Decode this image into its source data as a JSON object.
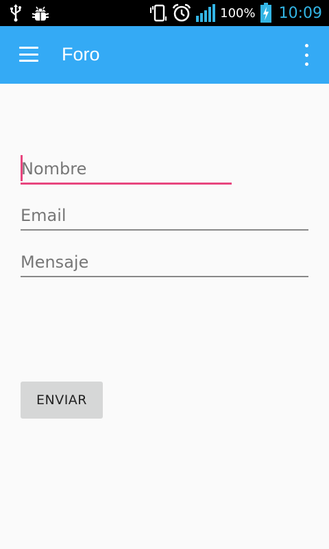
{
  "status_bar": {
    "icons": [
      "usb-icon",
      "android-debug-icon",
      "vibrate-icon",
      "alarm-icon",
      "signal-icon",
      "battery-charging-icon"
    ],
    "battery_percent": "100%",
    "time": "10:09",
    "clock_color": "#33b5e5"
  },
  "app_bar": {
    "title": "Foro",
    "background_color": "#34aaf5",
    "menu_icon": "hamburger-menu-icon",
    "overflow_icon": "more-vertical-icon"
  },
  "form": {
    "nombre": {
      "placeholder": "Nombre",
      "value": "",
      "focused": true,
      "accent_color": "#e8457e"
    },
    "email": {
      "placeholder": "Email",
      "value": ""
    },
    "mensaje": {
      "placeholder": "Mensaje",
      "value": ""
    },
    "submit_label": "ENVIAR"
  }
}
